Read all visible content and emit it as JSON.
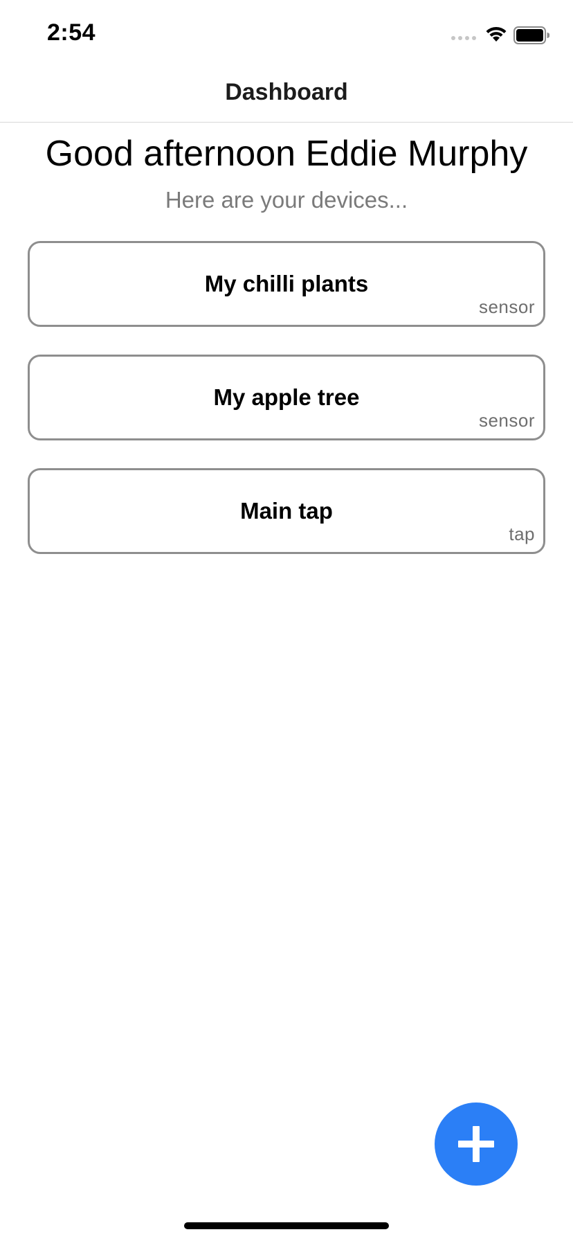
{
  "status_bar": {
    "time": "2:54"
  },
  "nav": {
    "title": "Dashboard"
  },
  "greeting": "Good afternoon Eddie Murphy",
  "subtitle": "Here are your devices...",
  "devices": [
    {
      "name": "My chilli plants",
      "type": "sensor"
    },
    {
      "name": "My apple tree",
      "type": "sensor"
    },
    {
      "name": "Main tap",
      "type": "tap"
    }
  ],
  "icons": {
    "add": "plus-icon",
    "wifi": "wifi-icon",
    "battery": "battery-icon",
    "signal": "signal-icon"
  },
  "colors": {
    "accent": "#2b7ff6",
    "card_border": "#8e8e8e",
    "subtitle_text": "#7a7a7a",
    "device_type_text": "#6e6e6e"
  }
}
